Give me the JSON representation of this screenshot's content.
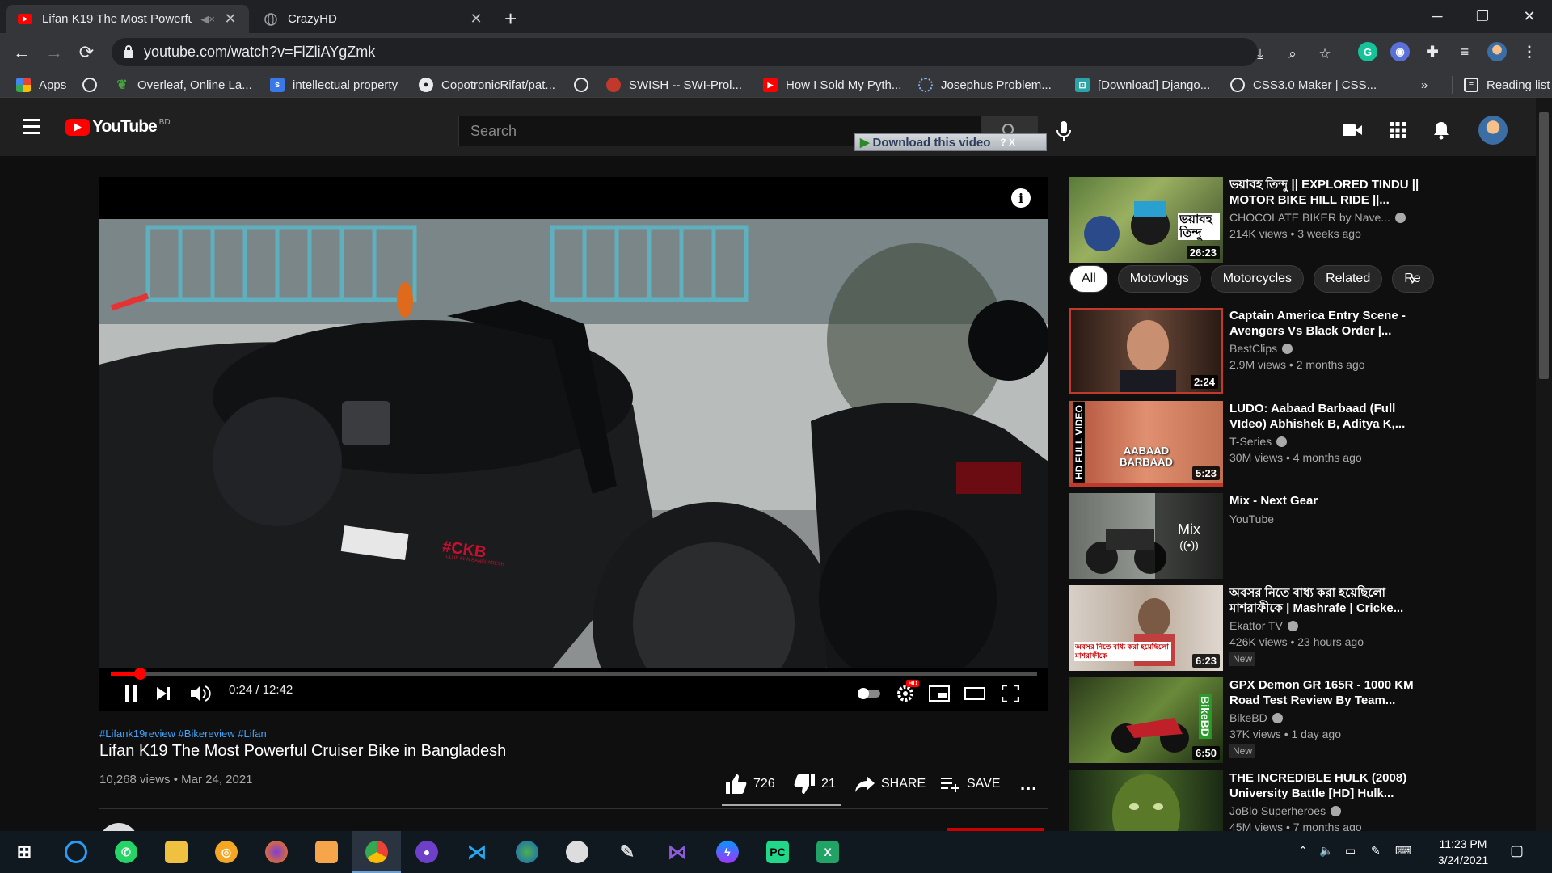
{
  "browser": {
    "tabs": [
      {
        "title": "Lifan K19 The Most Powerful",
        "icon": "youtube-icon",
        "active": true
      },
      {
        "title": "CrazyHD",
        "icon": "globe-icon",
        "active": false
      }
    ],
    "url": "youtube.com/watch?v=FlZliAYgZmk",
    "bookmarks": [
      {
        "label": "Apps",
        "icon": "apps-grid-icon"
      },
      {
        "label": "",
        "icon": "globe-icon"
      },
      {
        "label": "Overleaf, Online La...",
        "icon": "overleaf-icon"
      },
      {
        "label": "intellectual property",
        "icon": "s-blue-icon"
      },
      {
        "label": "CopotronicRifat/pat...",
        "icon": "github-icon"
      },
      {
        "label": "",
        "icon": "globe-icon"
      },
      {
        "label": "SWISH -- SWI-Prol...",
        "icon": "swish-icon"
      },
      {
        "label": "How I Sold My Pyth...",
        "icon": "youtube-icon"
      },
      {
        "label": "Josephus Problem...",
        "icon": "loading-icon"
      },
      {
        "label": "[Download] Django...",
        "icon": "django-icon"
      },
      {
        "label": "CSS3.0 Maker | CSS...",
        "icon": "globe-icon"
      }
    ],
    "overflow": "»",
    "reading_list": "Reading list"
  },
  "youtube": {
    "logo_text": "YouTube",
    "country": "BD",
    "search_placeholder": "Search",
    "download_btn": "Download this video",
    "download_extras": "? X"
  },
  "player": {
    "current_time": "0:24",
    "total_time": "12:42",
    "time_display": "0:24 / 12:42",
    "progress": 0.031,
    "hd_badge": "HD",
    "sticker_text": "#CKB",
    "sticker_sub": "CLUB KHN BANGLADESH"
  },
  "video": {
    "hashtags": "#Lifank19review #Bikereview #Lifan",
    "title": "Lifan K19 The Most Powerful Cruiser Bike in Bangladesh",
    "meta": "10,268 views • Mar 24, 2021",
    "likes": "726",
    "dislikes": "21",
    "share": "SHARE",
    "save": "SAVE",
    "more": "..."
  },
  "chips": [
    "All",
    "Motovlogs",
    "Motorcycles",
    "Related",
    "Re"
  ],
  "recommendations": [
    {
      "title": "ভয়াবহ তিন্দু || EXPLORED TINDU || MOTOR BIKE HILL RIDE ||...",
      "channel": "CHOCOLATE BIKER by Nave...",
      "verified": true,
      "views": "214K views • 3 weeks ago",
      "duration": "26:23",
      "thumb_text": "ভয়াবহ তিন্দু",
      "new": ""
    },
    {
      "title": "Captain America Entry Scene - Avengers Vs Black Order |...",
      "channel": "BestClips",
      "verified": true,
      "views": "2.9M views • 2 months ago",
      "duration": "2:24",
      "thumb_text": "",
      "new": ""
    },
    {
      "title": "LUDO: Aabaad Barbaad (Full VIdeo) Abhishek B, Aditya K,...",
      "channel": "T-Series",
      "verified": true,
      "views": "30M views • 4 months ago",
      "duration": "5:23",
      "thumb_text": "AABAAD BARBAAD",
      "thumb_side": "HD FULL VIDEO",
      "new": ""
    },
    {
      "title": "Mix - Next Gear",
      "channel": "YouTube",
      "verified": false,
      "views": "",
      "duration": "",
      "thumb_text": "Mix",
      "new": ""
    },
    {
      "title": "অবসর নিতে বাধ্য করা হয়েছিলো মাশরাফীকে | Mashrafe | Cricke...",
      "channel": "Ekattor TV",
      "verified": true,
      "views": "426K views • 23 hours ago",
      "duration": "6:23",
      "thumb_text": "অবসর নিতে বাধ্য করা হয়েছিলো মাশরাফীকে",
      "new": "New"
    },
    {
      "title": "GPX Demon GR 165R - 1000 KM Road Test Review By Team...",
      "channel": "BikeBD",
      "verified": true,
      "views": "37K views • 1 day ago",
      "duration": "6:50",
      "thumb_text": "BikeBD",
      "new": "New"
    },
    {
      "title": "THE INCREDIBLE HULK (2008) University Battle [HD] Hulk...",
      "channel": "JoBlo Superheroes",
      "verified": true,
      "views": "45M views • 7 months ago",
      "duration": "",
      "thumb_text": "",
      "new": ""
    }
  ],
  "taskbar": {
    "time": "11:23 PM",
    "date": "3/24/2021"
  },
  "colors": {
    "accent": "#ff0000",
    "background": "#0f0f0f",
    "link": "#3ea6ff"
  }
}
